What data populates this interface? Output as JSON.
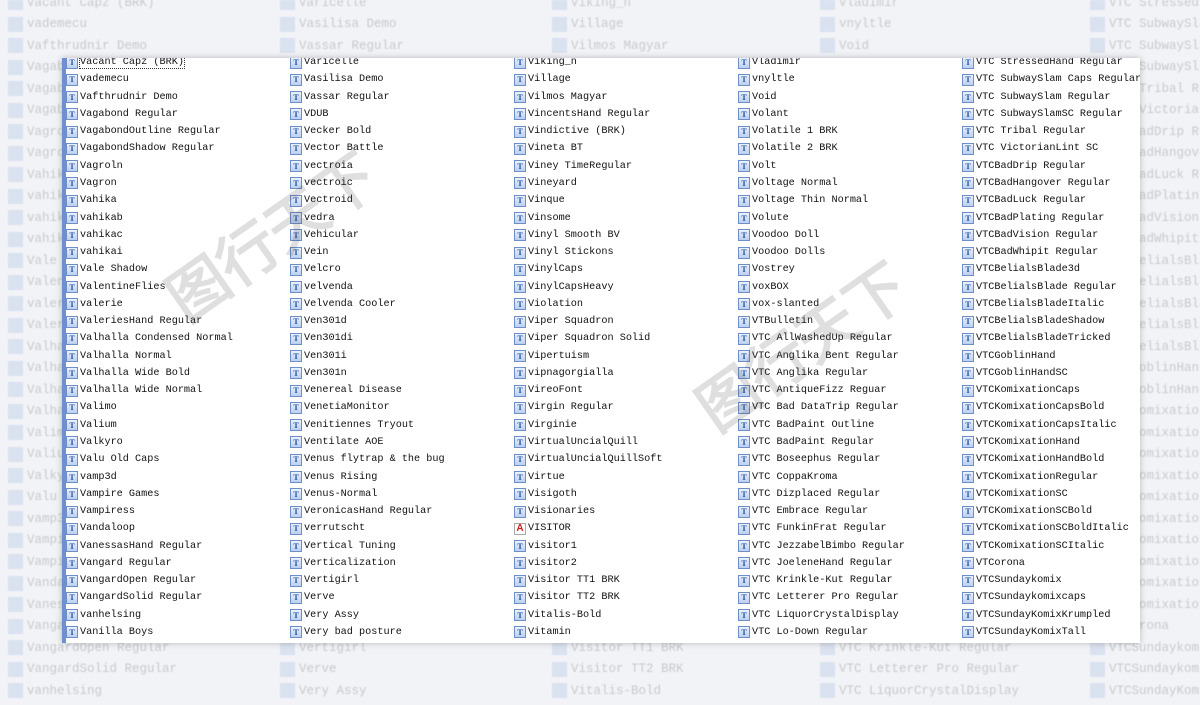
{
  "colors": {
    "accent": "#6f8fd0",
    "icon_truetype": "#1c4fa8",
    "icon_type1": "#c82020"
  },
  "icons": {
    "truetype": "truetype-font-icon",
    "type1": "opentype-font-icon"
  },
  "columns": [
    [
      "Vacant Capz (BRK)",
      "vademecu",
      "Vafthrudnir Demo",
      "Vagabond Regular",
      "VagabondOutline Regular",
      "VagabondShadow Regular",
      "Vagroln",
      "Vagron",
      "Vahika",
      "vahikab",
      "vahikac",
      "vahikai",
      "Vale Shadow",
      "ValentineFlies",
      "valerie",
      "ValeriesHand Regular",
      "Valhalla Condensed Normal",
      "Valhalla Normal",
      "Valhalla Wide Bold",
      "Valhalla Wide Normal",
      "Valimo",
      "Valium",
      "Valkyro",
      "Valu Old Caps",
      "vamp3d",
      "Vampire Games",
      "Vampiress",
      "Vandaloop",
      "VanessasHand Regular",
      "Vangard Regular",
      "VangardOpen Regular",
      "VangardSolid Regular",
      "vanhelsing",
      "Vanilla Boys"
    ],
    [
      "Varicelle",
      "Vasilisa Demo",
      "Vassar Regular",
      "VDUB",
      "Vecker Bold",
      "Vector Battle",
      "vectroia",
      "vectroic",
      "Vectroid",
      "vedra",
      "Vehicular",
      "Vein",
      "Velcro",
      "velvenda",
      "Velvenda Cooler",
      "Ven301d",
      "Ven301di",
      "Ven301i",
      "Ven301n",
      "Venereal Disease",
      "VenetiaMonitor",
      "Venitiennes Tryout",
      "Ventilate AOE",
      "Venus flytrap & the bug",
      "Venus Rising",
      "Venus-Normal",
      "VeronicasHand Regular",
      "verrutscht",
      "Vertical Tuning",
      "Verticalization",
      "Vertigirl",
      "Verve",
      "Very Assy",
      "Very bad posture"
    ],
    [
      "Viking_n",
      "Village",
      "Vilmos Magyar",
      "VincentsHand Regular",
      "Vindictive (BRK)",
      "Vineta BT",
      "Viney TimeRegular",
      "Vineyard",
      "Vinque",
      "Vinsome",
      "Vinyl Smooth BV",
      "Vinyl Stickons",
      "VinylCaps",
      "VinylCapsHeavy",
      "Violation",
      "Viper Squadron",
      "Viper Squadron Solid",
      "Vipertuism",
      "vipnagorgialla",
      "VireoFont",
      "Virgin Regular",
      "Virginie",
      "VirtualUncialQuill",
      "VirtualUncialQuillSoft",
      "Virtue",
      "Visigoth",
      "Visionaries",
      "VISITOR",
      "visitor1",
      "visitor2",
      "Visitor TT1 BRK",
      "Visitor TT2 BRK",
      "Vitalis-Bold",
      "Vitamin"
    ],
    [
      "Vladimir",
      "vnyltle",
      "Void",
      "Volant",
      "Volatile 1 BRK",
      "Volatile 2 BRK",
      "Volt",
      "Voltage Normal",
      "Voltage Thin Normal",
      "Volute",
      "Voodoo Doll",
      "Voodoo Dolls",
      "Vostrey",
      "voxBOX",
      "vox-slanted",
      "VTBulletin",
      "VTC AllWashedUp Regular",
      "VTC Anglika Bent Regular",
      "VTC Anglika Regular",
      "VTC AntiqueFizz Reguar",
      "VTC Bad DataTrip Regular",
      "VTC BadPaint Outline",
      "VTC BadPaint Regular",
      "VTC Boseephus Regular",
      "VTC CoppaKroma",
      "VTC Dizplaced Regular",
      "VTC Embrace Regular",
      "VTC FunkinFrat Regular",
      "VTC JezzabelBimbo Regular",
      "VTC JoeleneHand Regular",
      "VTC Krinkle-Kut Regular",
      "VTC Letterer Pro Regular",
      "VTC LiquorCrystalDisplay",
      "VTC Lo-Down Regular"
    ],
    [
      "VTC StressedHand Regular",
      "VTC SubwaySlam Caps Regular",
      "VTC SubwaySlam Regular",
      "VTC SubwaySlamSC Regular",
      "VTC Tribal Regular",
      "VTC VictorianLint SC",
      "VTCBadDrip Regular",
      "VTCBadHangover Regular",
      "VTCBadLuck Regular",
      "VTCBadPlating Regular",
      "VTCBadVision Regular",
      "VTCBadWhipit Regular",
      "VTCBelialsBlade3d",
      "VTCBelialsBlade Regular",
      "VTCBelialsBladeItalic",
      "VTCBelialsBladeShadow",
      "VTCBelialsBladeTricked",
      "VTCGoblinHand",
      "VTCGoblinHandSC",
      "VTCKomixationCaps",
      "VTCKomixationCapsBold",
      "VTCKomixationCapsItalic",
      "VTCKomixationHand",
      "VTCKomixationHandBold",
      "VTCKomixationRegular",
      "VTCKomixationSC",
      "VTCKomixationSCBold",
      "VTCKomixationSCBoldItalic",
      "VTCKomixationSCItalic",
      "VTCorona",
      "VTCSundaykomix",
      "VTCSundaykomixcaps",
      "VTCSundayKomixKrumpled",
      "VTCSundayKomixTall"
    ]
  ],
  "type1_items": [
    "VISITOR"
  ],
  "selected_item": "Vacant Capz (BRK)",
  "watermark": {
    "brand": "图行天下",
    "site": "PHOTOPHOTO.CN"
  }
}
